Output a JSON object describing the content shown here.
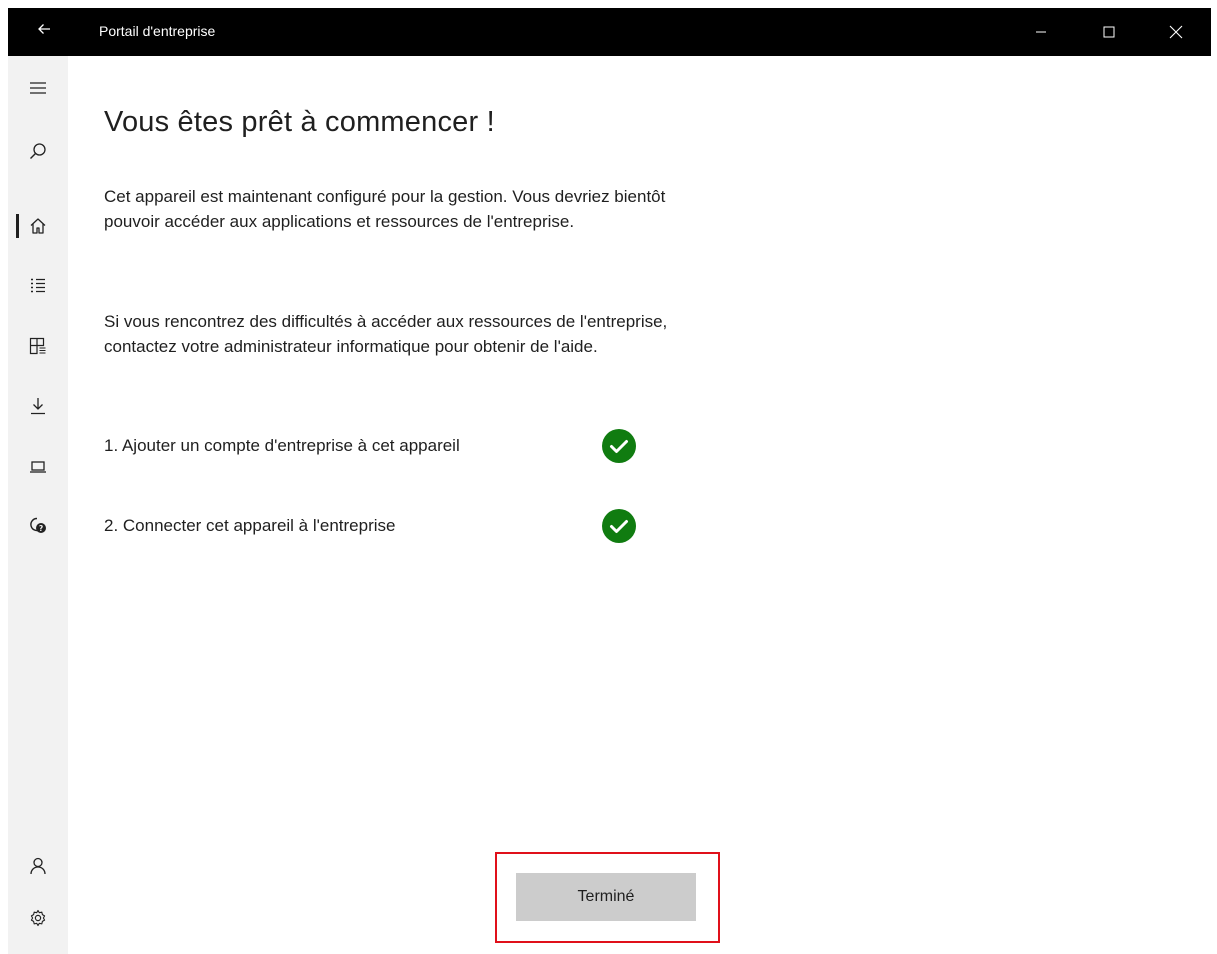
{
  "titlebar": {
    "back_icon": "back-arrow-icon",
    "title": "Portail d'entreprise",
    "minimize_icon": "minimize-icon",
    "maximize_icon": "maximize-icon",
    "close_icon": "close-icon",
    "background": "#000000"
  },
  "sidebar": {
    "items": [
      {
        "icon": "hamburger-menu-icon"
      },
      {
        "icon": "search-icon"
      },
      {
        "icon": "home-icon",
        "active": true
      },
      {
        "icon": "list-icon"
      },
      {
        "icon": "categories-icon"
      },
      {
        "icon": "download-icon"
      },
      {
        "icon": "device-icon"
      },
      {
        "icon": "help-support-icon"
      },
      {
        "icon": "account-icon"
      },
      {
        "icon": "settings-gear-icon"
      }
    ]
  },
  "main": {
    "title": "Vous êtes prêt à commencer !",
    "paragraph1": "Cet appareil est maintenant configuré pour la gestion. Vous devriez bientôt pouvoir accéder aux applications et ressources de l'entreprise.",
    "paragraph2": "Si vous rencontrez des difficultés à accéder aux ressources de l'entreprise, contactez votre administrateur informatique pour obtenir de l'aide.",
    "steps": [
      {
        "label": "1. Ajouter un compte d'entreprise à cet appareil",
        "status_icon": "check-circle-icon",
        "status_color": "#107c10"
      },
      {
        "label": "2. Connecter cet appareil à l'entreprise",
        "status_icon": "check-circle-icon",
        "status_color": "#107c10"
      }
    ],
    "done_button": "Terminé",
    "highlight_color": "#e0101a"
  }
}
